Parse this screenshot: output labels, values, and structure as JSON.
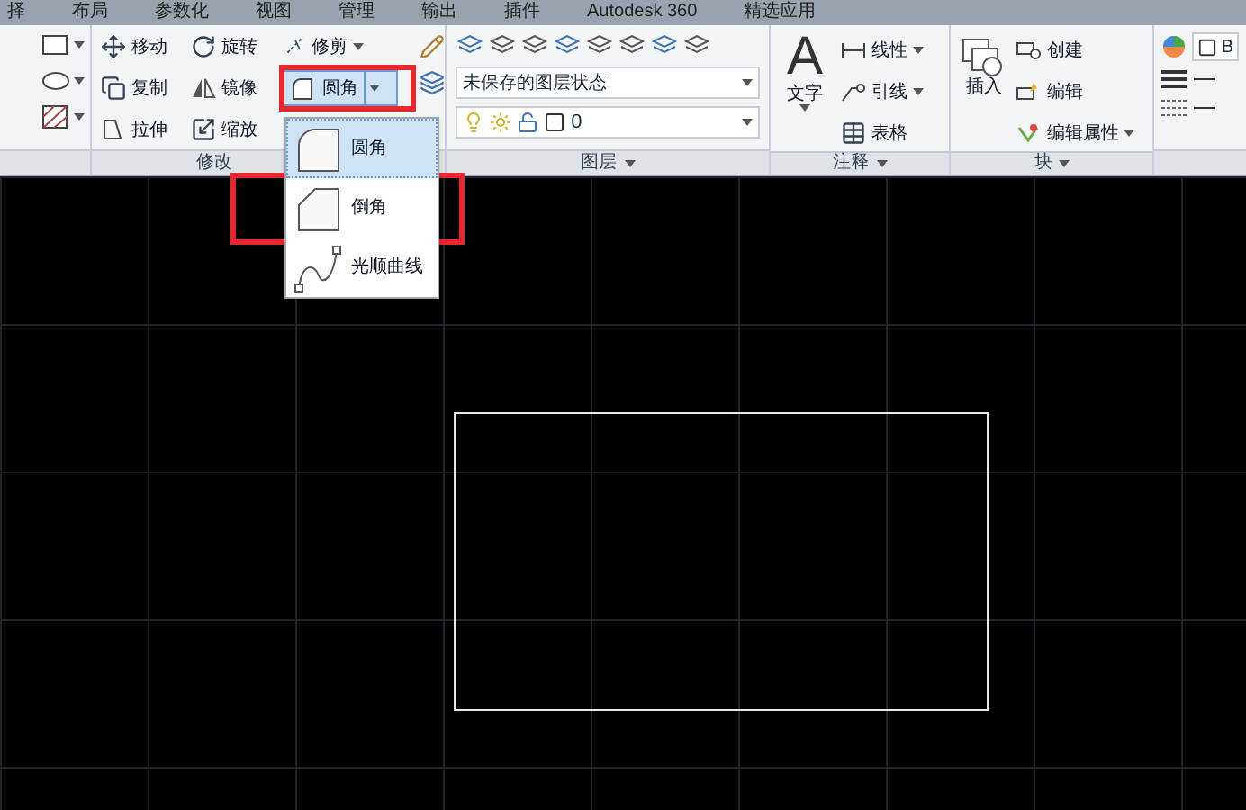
{
  "ribbon_tabs": [
    {
      "label": "择"
    },
    {
      "label": "布局"
    },
    {
      "label": "参数化"
    },
    {
      "label": "视图"
    },
    {
      "label": "管理"
    },
    {
      "label": "输出"
    },
    {
      "label": "插件"
    },
    {
      "label": "Autodesk 360"
    },
    {
      "label": "精选应用"
    }
  ],
  "modify_panel": {
    "title": "修改",
    "rows": [
      [
        {
          "kind": "move",
          "label": "移动",
          "dropdown": false
        },
        {
          "kind": "rotate",
          "label": "旋转",
          "dropdown": false
        },
        {
          "kind": "trim",
          "label": "修剪",
          "dropdown": true
        }
      ],
      [
        {
          "kind": "copy",
          "label": "复制",
          "dropdown": false
        },
        {
          "kind": "mirror",
          "label": "镜像",
          "dropdown": false
        }
      ],
      [
        {
          "kind": "stretch",
          "label": "拉伸",
          "dropdown": false
        },
        {
          "kind": "scale",
          "label": "缩放",
          "dropdown": false
        }
      ]
    ],
    "fillet_button": {
      "label": "圆角"
    }
  },
  "layer_panel": {
    "title": "图层",
    "layer_state": "未保存的图层状态",
    "current_layer": "0"
  },
  "annotation_panel": {
    "title": "注释",
    "big_tool": "文字",
    "big_tool_glyph": "A",
    "tools": [
      {
        "kind": "linear",
        "label": "线性",
        "dropdown": true
      },
      {
        "kind": "leader",
        "label": "引线",
        "dropdown": true
      },
      {
        "kind": "table",
        "label": "表格",
        "dropdown": false
      }
    ]
  },
  "block_panel": {
    "title": "块",
    "big_tool": "插入",
    "tools": [
      {
        "kind": "create",
        "label": "创建",
        "dropdown": false
      },
      {
        "kind": "edit",
        "label": "编辑",
        "dropdown": false
      },
      {
        "kind": "attr",
        "label": "编辑属性",
        "dropdown": true
      }
    ]
  },
  "properties_panel": {
    "color_label": "B"
  },
  "fillet_menu": {
    "items": [
      {
        "kind": "fillet",
        "label": "圆角",
        "selected": true
      },
      {
        "kind": "chamfer",
        "label": "倒角",
        "selected": false
      },
      {
        "kind": "spline",
        "label": "光顺曲线",
        "selected": false
      }
    ]
  }
}
